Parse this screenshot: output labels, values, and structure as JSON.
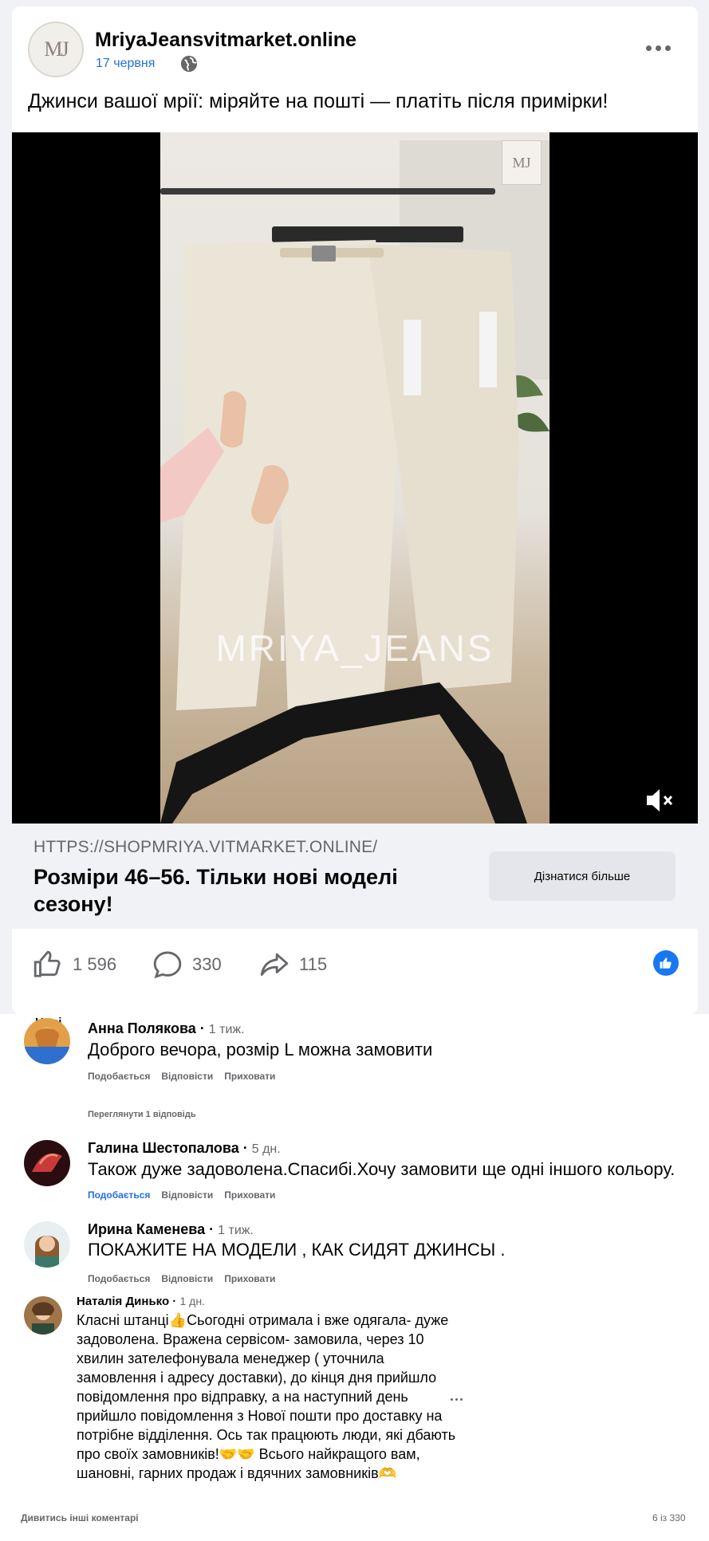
{
  "post": {
    "page_name": "MriyaJeansvitmarket.online",
    "date": "17 червня",
    "avatar_monogram": "MJ",
    "text": "Джинси вашої мрії: міряйте на пошті — платіть після примірки!"
  },
  "video": {
    "watermark": "MRIYA_JEANS",
    "badge": "MJ",
    "mute_icon": "speaker-muted-icon"
  },
  "link": {
    "url": "HTTPS://SHOPMRIYA.VITMARKET.ONLINE/",
    "title": "Розміри 46–56. Тільки нові моделі сезону!",
    "cta": "Дізнатися більше"
  },
  "stats": {
    "likes": "1 596",
    "comments": "330",
    "shares": "115"
  },
  "comments": {
    "filter": "Нові",
    "items": [
      {
        "name": "Анна Полякова",
        "time": "1 тиж.",
        "text": "Доброго вечора, розмір L можна замовити",
        "like": "Подобається",
        "reply": "Відповісти",
        "hide": "Приховати",
        "replies": "Переглянути 1 відповідь"
      },
      {
        "name": "Галина Шестопалова",
        "time": "5 дн.",
        "text": "Також дуже задоволена.Спасибі.Хочу замовити ще одні іншого кольору.",
        "like": "Подобається",
        "reply": "Відповісти",
        "hide": "Приховати"
      },
      {
        "name": "Ирина Каменева",
        "time": "1 тиж.",
        "text": "ПОКАЖИТЕ НА МОДЕЛИ , КАК СИДЯТ ДЖИНСЫ .",
        "like": "Подобається",
        "reply": "Відповісти",
        "hide": "Приховати"
      },
      {
        "name": "Наталія Динько",
        "time": "1 дн.",
        "text": "Класні штанці👍Сьогодні отримала і вже одягала- дуже задоволена. Вражена сервісом- замовила, через 10 хвилин зателефонувала менеджер ( уточнила замовлення і адресу доставки), до кінця дня прийшло повідомлення про відправку, а на наступний день прийшло повідомлення з Нової пошти про доставку на потрібне відділення. Ось так працюють люди, які дбають про своїх замовників!🤝🤝 Всього найкращого вам, шановні, гарних продаж і вдячних замовників🫶"
      }
    ],
    "view_more": "Дивитись інші коментарі",
    "count": "6 із 330"
  }
}
